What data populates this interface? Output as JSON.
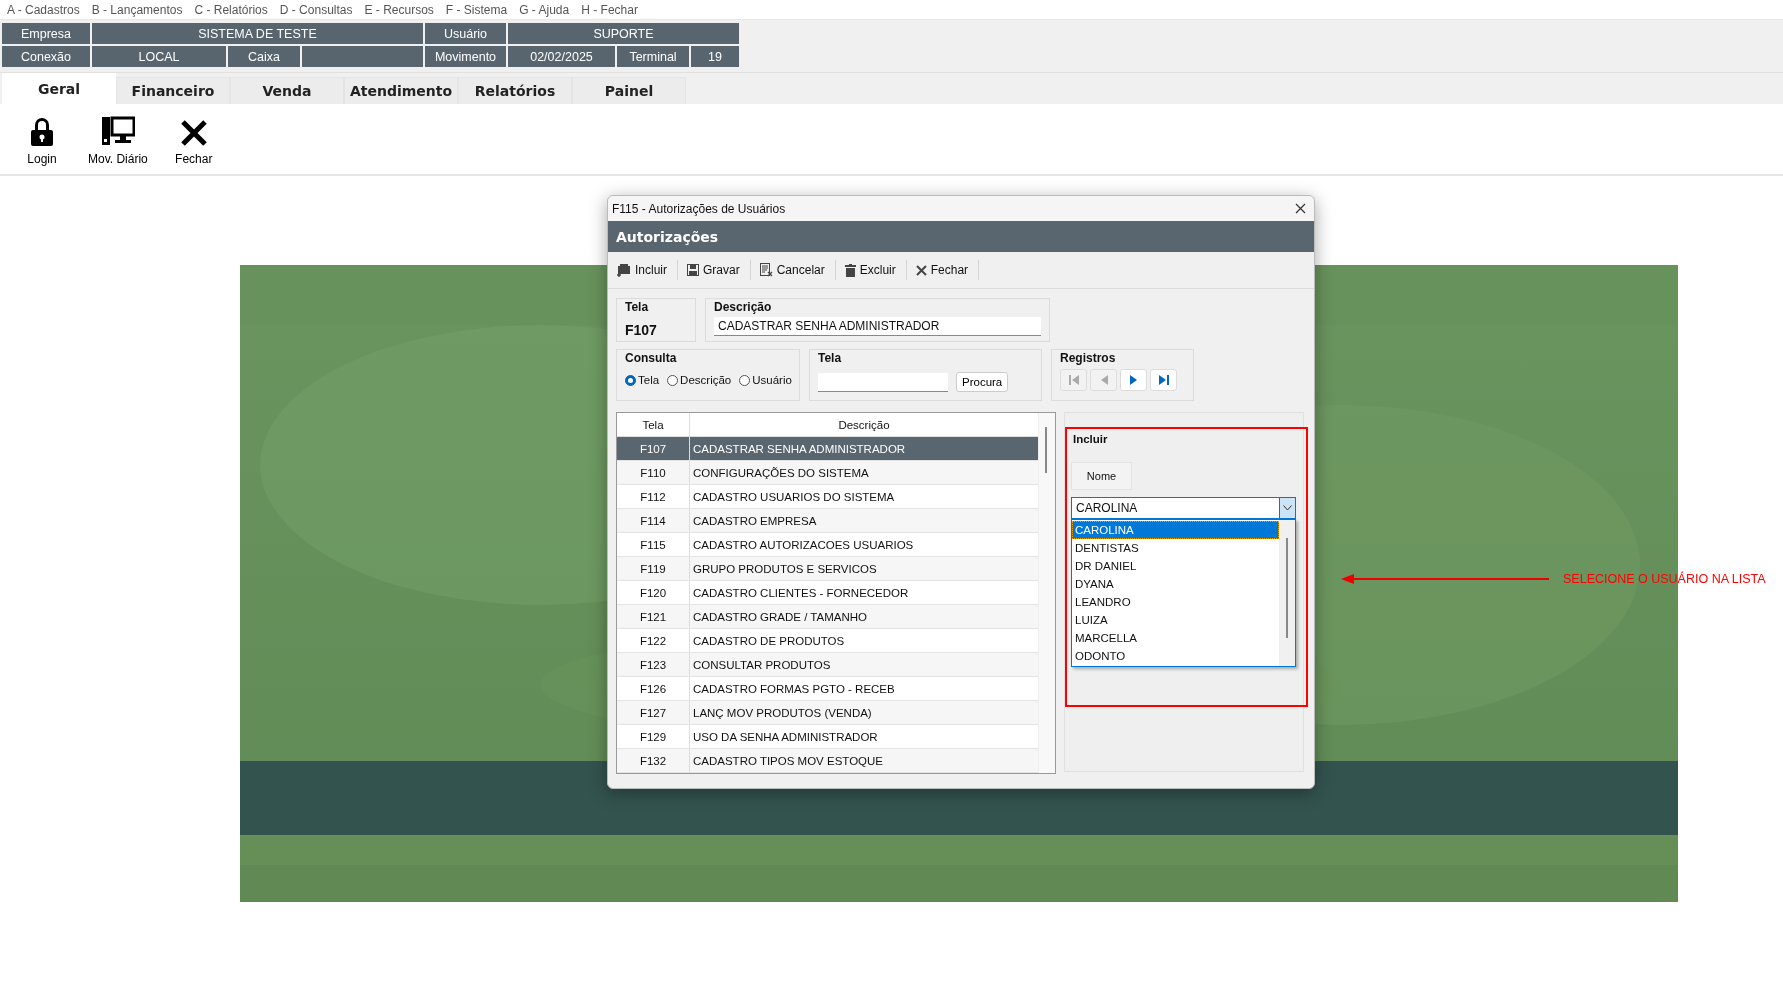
{
  "menu": [
    "A - Cadastros",
    "B - Lançamentos",
    "C - Relatórios",
    "D - Consultas",
    "E - Recursos",
    "F - Sistema",
    "G - Ajuda",
    "H - Fechar"
  ],
  "info_bar": {
    "top_line": [
      {
        "label": "Empresa",
        "value": "SISTEMA DE TESTE"
      },
      {
        "label": "Usuário",
        "value": "SUPORTE"
      }
    ],
    "bottom_line": [
      {
        "label": "Conexão",
        "value": "LOCAL"
      },
      {
        "label": "Caixa"
      },
      {
        "label": "Movimento",
        "value": "02/02/2025"
      },
      {
        "label": "Terminal",
        "value": "19"
      }
    ]
  },
  "tabs": [
    {
      "label": "Geral",
      "selected": true
    },
    {
      "label": "Financeiro",
      "selected": false
    },
    {
      "label": "Venda",
      "selected": false
    },
    {
      "label": "Atendimento",
      "selected": false
    },
    {
      "label": "Relatórios",
      "selected": false
    },
    {
      "label": "Painel",
      "selected": false
    }
  ],
  "ribbon": [
    {
      "kind": "lock",
      "label": "Login"
    },
    {
      "kind": "computer",
      "label": "Mov. Diário"
    },
    {
      "kind": "close",
      "label": "Fechar"
    }
  ],
  "dialog": {
    "title": "F115 - Autorizações de Usuários",
    "header": "Autorizações",
    "toolbar": [
      {
        "kind": "add",
        "label": "Incluir"
      },
      {
        "kind": "save",
        "label": "Gravar"
      },
      {
        "kind": "cancel",
        "label": "Cancelar"
      },
      {
        "kind": "delete",
        "label": "Excluir"
      },
      {
        "kind": "close",
        "label": "Fechar"
      }
    ],
    "tela": {
      "label": "Tela",
      "value": "F107"
    },
    "descricao": {
      "label": "Descrição",
      "value": "CADASTRAR SENHA ADMINISTRADOR"
    },
    "consulta": {
      "label": "Consulta",
      "options": [
        {
          "label": "Tela",
          "selected": true
        },
        {
          "label": "Descrição",
          "selected": false
        },
        {
          "label": "Usuário",
          "selected": false
        }
      ]
    },
    "search": {
      "label": "Tela",
      "button": "Procura"
    },
    "registros": {
      "label": "Registros",
      "buttons": [
        {
          "kind": "first",
          "disabled": true
        },
        {
          "kind": "prev",
          "disabled": true
        },
        {
          "kind": "next",
          "disabled": false
        },
        {
          "kind": "last",
          "disabled": false
        }
      ]
    },
    "table": {
      "columns": [
        "Tela",
        "Descrição"
      ],
      "rows": [
        {
          "tela": "F107",
          "descricao": "CADASTRAR SENHA ADMINISTRADOR",
          "selected": true
        },
        {
          "tela": "F110",
          "descricao": "CONFIGURAÇÕES DO SISTEMA",
          "selected": false
        },
        {
          "tela": "F112",
          "descricao": "CADASTRO USUARIOS DO SISTEMA",
          "selected": false
        },
        {
          "tela": "F114",
          "descricao": "CADASTRO EMPRESA",
          "selected": false
        },
        {
          "tela": "F115",
          "descricao": "CADASTRO AUTORIZACOES USUARIOS",
          "selected": false
        },
        {
          "tela": "F119",
          "descricao": "GRUPO PRODUTOS E SERVICOS",
          "selected": false
        },
        {
          "tela": "F120",
          "descricao": "CADASTRO CLIENTES - FORNECEDOR",
          "selected": false
        },
        {
          "tela": "F121",
          "descricao": "CADASTRO GRADE / TAMANHO",
          "selected": false
        },
        {
          "tela": "F122",
          "descricao": "CADASTRO DE PRODUTOS",
          "selected": false
        },
        {
          "tela": "F123",
          "descricao": "CONSULTAR PRODUTOS",
          "selected": false
        },
        {
          "tela": "F126",
          "descricao": "CADASTRO FORMAS PGTO - RECEB",
          "selected": false
        },
        {
          "tela": "F127",
          "descricao": "LANÇ MOV PRODUTOS (VENDA)",
          "selected": false
        },
        {
          "tela": "F129",
          "descricao": "USO DA SENHA ADMINISTRADOR",
          "selected": false
        },
        {
          "tela": "F132",
          "descricao": "CADASTRO TIPOS MOV ESTOQUE",
          "selected": false
        }
      ]
    },
    "incluir": {
      "title": "Incluir",
      "column": "Nome",
      "value": "CAROLINA",
      "expanded": true,
      "options": [
        {
          "label": "CAROLINA",
          "selected": true
        },
        {
          "label": "DENTISTAS",
          "selected": false
        },
        {
          "label": "DR DANIEL",
          "selected": false
        },
        {
          "label": "DYANA",
          "selected": false
        },
        {
          "label": "LEANDRO",
          "selected": false
        },
        {
          "label": "LUIZA",
          "selected": false
        },
        {
          "label": "MARCELLA",
          "selected": false
        },
        {
          "label": "ODONTO",
          "selected": false
        }
      ]
    }
  },
  "annotation": {
    "text": "SELECIONE O USUÁRIO NA LISTA"
  }
}
